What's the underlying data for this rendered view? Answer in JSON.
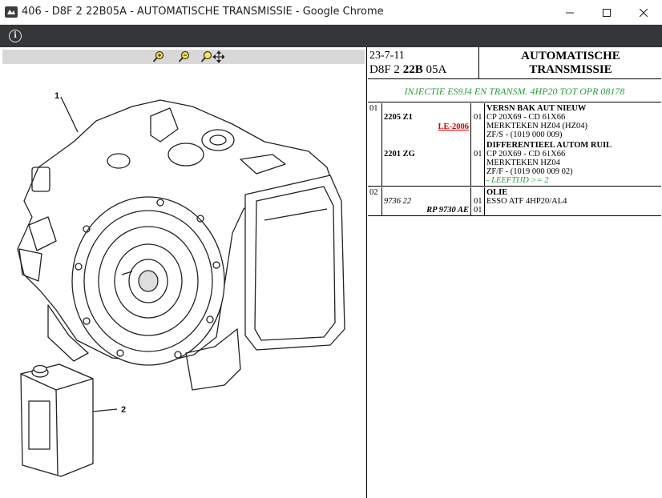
{
  "window": {
    "title": "406 - D8F 2 22B05A - AUTOMATISCHE TRANSMISSIE - Google Chrome",
    "minimize_icon": "minimize-icon",
    "maximize_icon": "maximize-icon",
    "close_icon": "close-icon"
  },
  "infobar": {
    "icon": "info-icon",
    "glyph": "i"
  },
  "drawing": {
    "toolbar": {
      "zoom_in": "zoom-in-icon",
      "zoom_out": "zoom-out-icon",
      "pan": "zoom-pan-icon"
    },
    "callouts": [
      "1",
      "2"
    ]
  },
  "sheet": {
    "date": "23-7-11",
    "code_prefix": "D8F 2 ",
    "code_bold": "22B",
    "code_suffix": " 05A",
    "title_line1": "AUTOMATISCHE",
    "title_line2": "TRANSMISSIE",
    "subtitle": "INJECTIE ES9J4 EN TRANSM. 4HP20 TOT OPR 08178",
    "groups": [
      {
        "group": "01",
        "items": [
          {
            "ref": "2205 Z1",
            "note": "LE-2006",
            "qty": "01",
            "lines": [
              "VERSN BAK AUT NIEUW",
              "CP 20X69 - CD 61X66",
              "MERKTEKEN HZ04 (HZ04)",
              "ZF/S - (1019 000 009)"
            ]
          },
          {
            "ref": "2201 ZG",
            "qty": "01",
            "lines": [
              "DIFFERENTIEEL AUTOM RUIL",
              "CP 20X69 - CD 61X66",
              "MERKTEKEN HZ04",
              "ZF/F - (1019 000 009 02)"
            ],
            "remark": "- LEEFTIJD >= 2"
          }
        ]
      },
      {
        "group": "02",
        "items": [
          {
            "ref": "9736 22",
            "ref2": "RP 9730 AE",
            "qty": "01",
            "qty2": "01",
            "lines": [
              "OLIE",
              "ESSO ATF 4HP20/AL4"
            ]
          }
        ]
      }
    ]
  }
}
